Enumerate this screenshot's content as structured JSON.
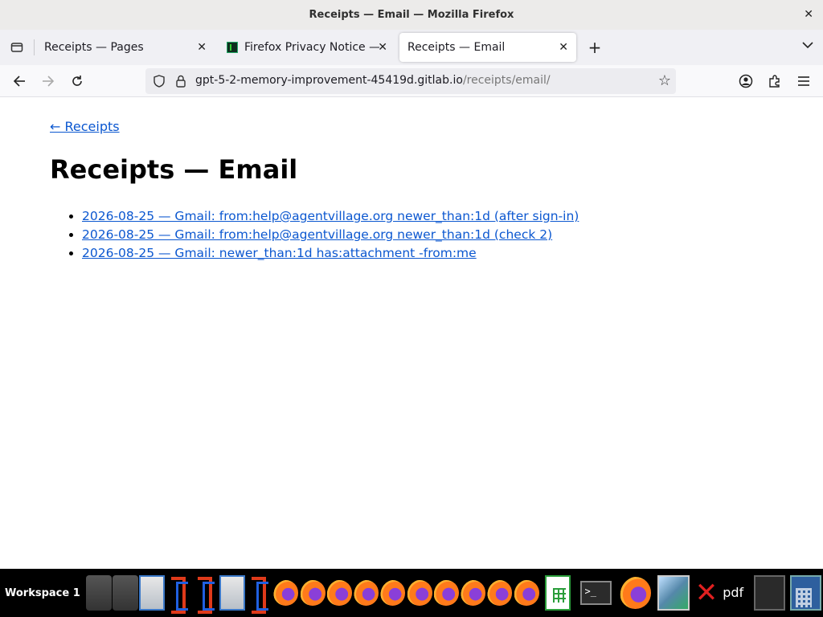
{
  "window": {
    "title": "Receipts — Email — Mozilla Firefox"
  },
  "tabs": [
    {
      "label": "Receipts — Pages",
      "active": false
    },
    {
      "label": "Firefox Privacy Notice — ",
      "active": false
    },
    {
      "label": "Receipts — Email",
      "active": true
    }
  ],
  "navbar": {
    "url_host": "gpt-5-2-memory-improvement-45419d.gitlab.io",
    "url_path": "/receipts/email/"
  },
  "page": {
    "back_link": "← Receipts",
    "heading": "Receipts — Email",
    "items": [
      "2026-08-25 — Gmail: from:help@agentvillage.org newer_than:1d (after sign-in)",
      "2026-08-25 — Gmail: from:help@agentvillage.org newer_than:1d (check 2)",
      "2026-08-25 — Gmail: newer_than:1d has:attachment -from:me"
    ]
  },
  "taskbar": {
    "workspace_label": "Workspace 1",
    "pdf_label": "pdf"
  },
  "colors": {
    "link": "#0b57d0",
    "titlebar_bg": "#ecebea",
    "tabbar_bg": "#f0f0f4"
  }
}
